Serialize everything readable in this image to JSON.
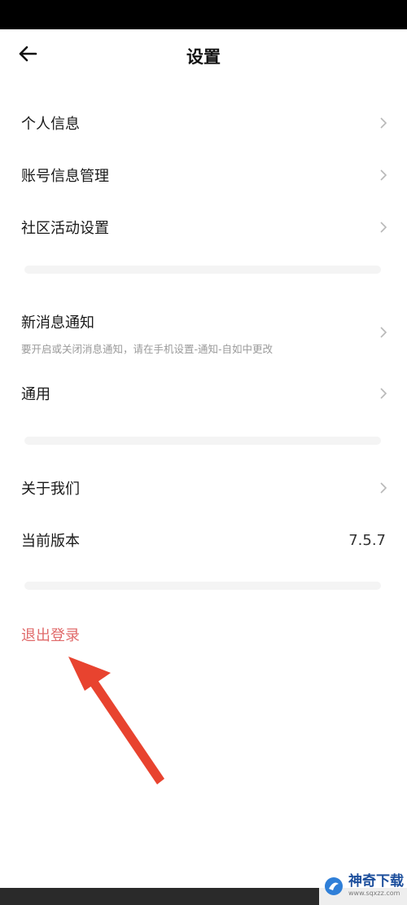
{
  "header": {
    "title": "设置"
  },
  "section1": [
    {
      "label": "个人信息"
    },
    {
      "label": "账号信息管理"
    },
    {
      "label": "社区活动设置"
    }
  ],
  "section2": {
    "notify": {
      "label": "新消息通知",
      "sub": "要开启或关闭消息通知，请在手机设置-通知-自如中更改"
    },
    "general": {
      "label": "通用"
    }
  },
  "section3": {
    "about": {
      "label": "关于我们"
    },
    "version": {
      "label": "当前版本",
      "value": "7.5.7"
    }
  },
  "logout": {
    "label": "退出登录"
  },
  "watermark": {
    "name": "神奇下载",
    "url": "www.sqxzz.com"
  },
  "colors": {
    "logout": "#e06a6a",
    "annotation_arrow": "#e8432f"
  },
  "icons": {
    "back": "arrow-left-icon",
    "chevron": "chevron-right-icon",
    "annotation": "red-arrow-annotation"
  }
}
